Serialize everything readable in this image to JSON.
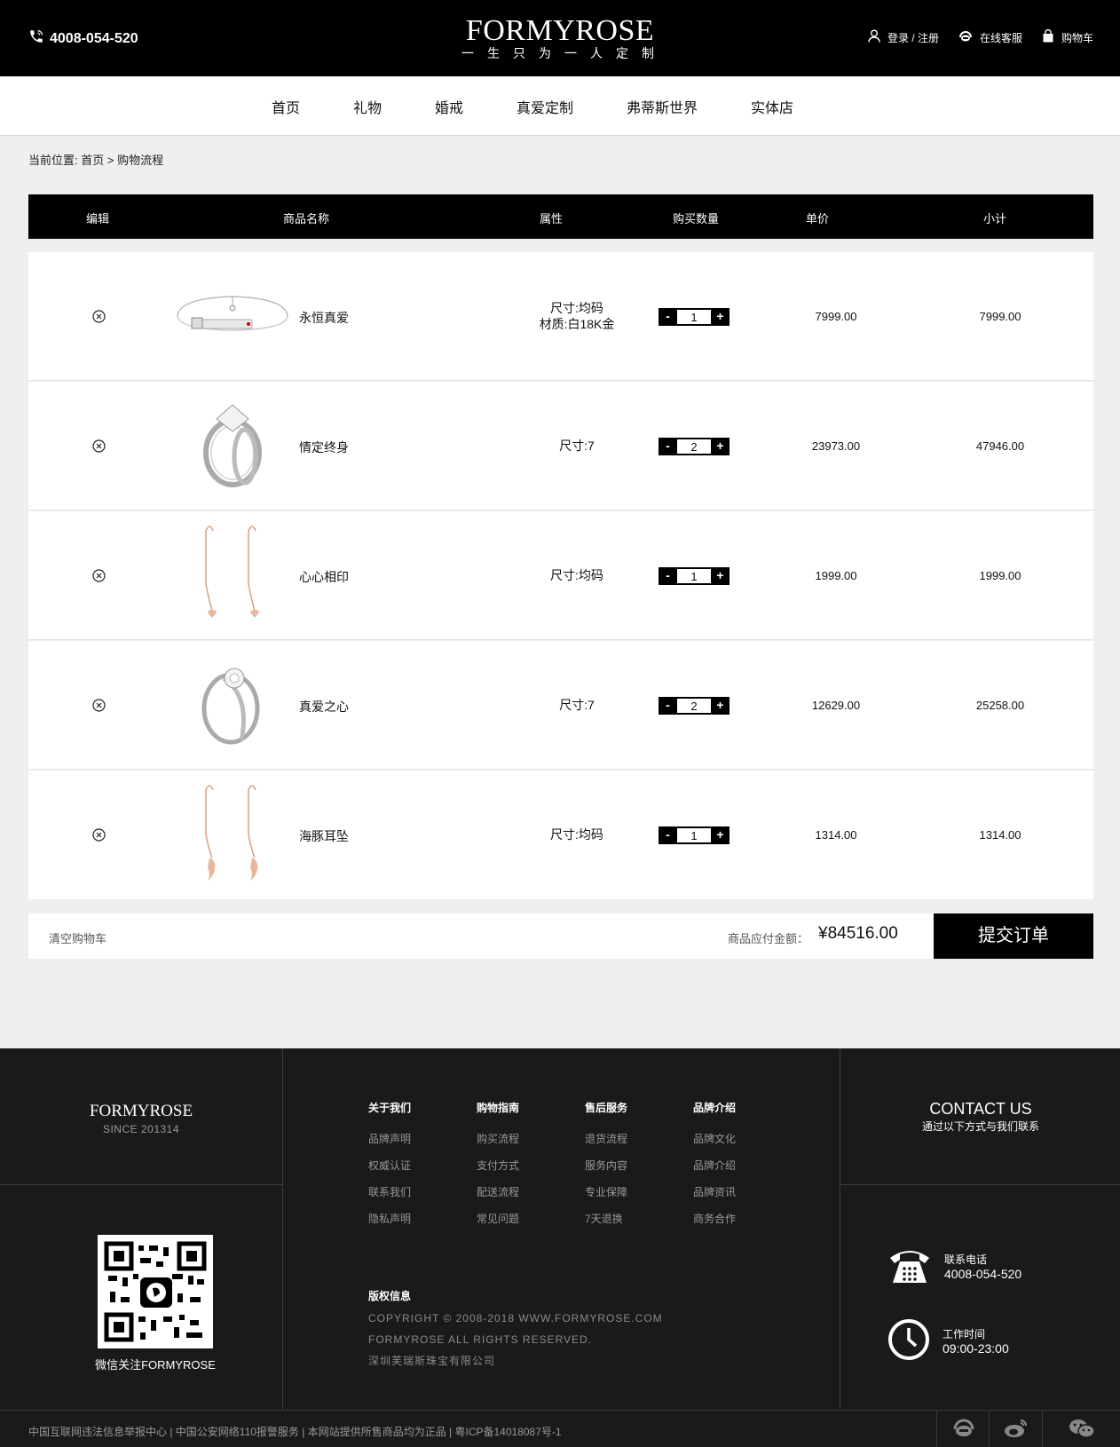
{
  "header": {
    "phone": "4008-054-520",
    "logo": "FORMYROSE",
    "tagline": "一生只为一人定制",
    "login": "登录 / 注册",
    "service": "在线客服",
    "cart": "购物车"
  },
  "nav": [
    "首页",
    "礼物",
    "婚戒",
    "真爱定制",
    "弗蒂斯世界",
    "实体店"
  ],
  "breadcrumb": {
    "prefix": "当前位置:",
    "home": "首页",
    "current": "购物流程"
  },
  "table": {
    "headers": [
      "编辑",
      "商品名称",
      "属性",
      "购买数量",
      "单价",
      "小计"
    ],
    "rows": [
      {
        "name": "永恒真爱",
        "attrs": [
          "尺寸:均码",
          "材质:白18K金"
        ],
        "qty": "1",
        "price": "7999.00",
        "subtotal": "7999.00",
        "image": "bracelet-image"
      },
      {
        "name": "情定终身",
        "attrs": [
          "尺寸:7"
        ],
        "qty": "2",
        "price": "23973.00",
        "subtotal": "47946.00",
        "image": "ring-image"
      },
      {
        "name": "心心相印",
        "attrs": [
          "尺寸:均码"
        ],
        "qty": "1",
        "price": "1999.00",
        "subtotal": "1999.00",
        "image": "earring-image"
      },
      {
        "name": "真爱之心",
        "attrs": [
          "尺寸:7"
        ],
        "qty": "2",
        "price": "12629.00",
        "subtotal": "25258.00",
        "image": "ring-image"
      },
      {
        "name": "海豚耳坠",
        "attrs": [
          "尺寸:均码"
        ],
        "qty": "1",
        "price": "1314.00",
        "subtotal": "1314.00",
        "image": "earring-image"
      }
    ],
    "minus": "-",
    "plus": "+"
  },
  "summary": {
    "clear": "清空购物车",
    "total_label": "商品应付金额：",
    "total": "¥84516.00",
    "submit": "提交订单"
  },
  "footer": {
    "brand": "FORMYROSE",
    "since": "SINCE 201314",
    "qr_label": "微信关注FORMYROSE",
    "columns": [
      {
        "title": "关于我们",
        "links": [
          "品牌声明",
          "权威认证",
          "联系我们",
          "隐私声明"
        ]
      },
      {
        "title": "购物指南",
        "links": [
          "购买流程",
          "支付方式",
          "配送流程",
          "常见问题"
        ]
      },
      {
        "title": "售后服务",
        "links": [
          "退货流程",
          "服务内容",
          "专业保障",
          "7天退换"
        ]
      },
      {
        "title": "品牌介绍",
        "links": [
          "品牌文化",
          "品牌介绍",
          "品牌资讯",
          "商务合作"
        ]
      }
    ],
    "copyright": {
      "title": "版权信息",
      "line1": "COPYRIGHT © 2008-2018 WWW.FORMYROSE.COM",
      "line2": "FORMYROSE ALL RIGHTS RESERVED.",
      "line3": "深圳芙瑞斯珠宝有限公司"
    },
    "contact": {
      "title": "CONTACT US",
      "subtitle": "通过以下方式与我们联系",
      "phone_label": "联系电话",
      "phone": "4008-054-520",
      "hours_label": "工作时间",
      "hours": "09:00-23:00"
    },
    "legal": "中国互联网违法信息举报中心 | 中国公安网络110报警服务 | 本网站提供所售商品均为正品 | 粤ICP备14018087号-1"
  },
  "colors": {
    "primary": "#000000",
    "footer_bg": "#1a1a1c",
    "page_bg": "#efefef"
  }
}
